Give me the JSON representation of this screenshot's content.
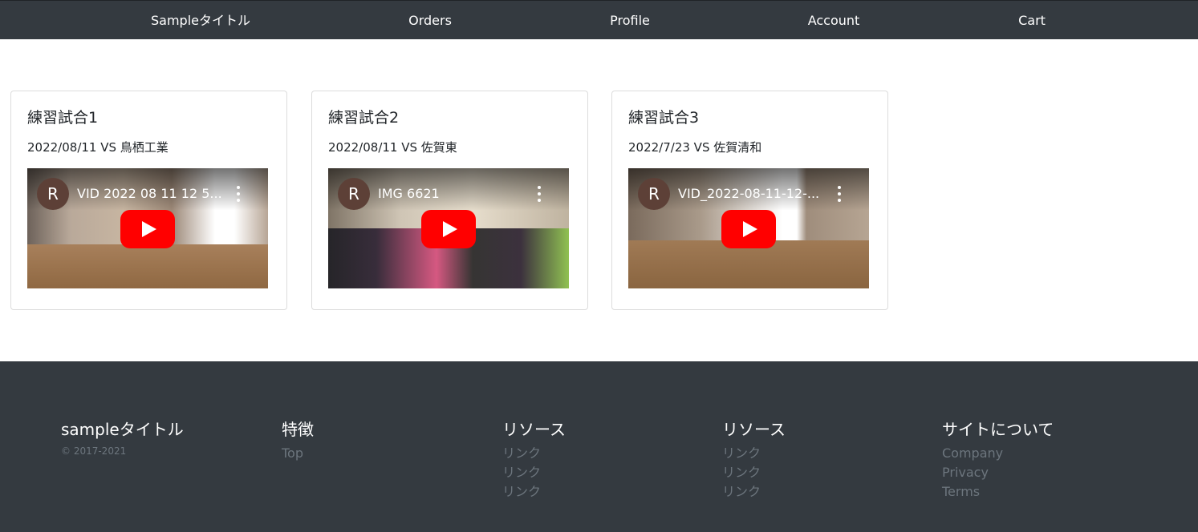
{
  "nav": {
    "items": [
      {
        "label": "Sampleタイトル"
      },
      {
        "label": "Orders"
      },
      {
        "label": "Profile"
      },
      {
        "label": "Account"
      },
      {
        "label": "Cart"
      }
    ]
  },
  "cards": [
    {
      "title": "練習試合1",
      "subtitle": "2022/08/11 VS 鳥栖工業",
      "video": {
        "channel_initial": "R",
        "title": "VID 2022 08 11 12 5...",
        "icon": "youtube-play-icon"
      }
    },
    {
      "title": "練習試合2",
      "subtitle": "2022/08/11 VS 佐賀東",
      "video": {
        "channel_initial": "R",
        "title": "IMG 6621",
        "icon": "youtube-play-icon"
      }
    },
    {
      "title": "練習試合3",
      "subtitle": "2022/7/23 VS 佐賀清和",
      "video": {
        "channel_initial": "R",
        "title": "VID_2022-08-11-12-...",
        "icon": "youtube-play-icon"
      }
    }
  ],
  "footer": {
    "brand": "sampleタイトル",
    "copyright": "© 2017-2021",
    "columns": [
      {
        "heading": "特徴",
        "links": [
          "Top"
        ]
      },
      {
        "heading": "リソース",
        "links": [
          "リンク",
          "リンク",
          "リンク"
        ]
      },
      {
        "heading": "リソース",
        "links": [
          "リンク",
          "リンク",
          "リンク"
        ]
      },
      {
        "heading": "サイトについて",
        "links": [
          "Company",
          "Privacy",
          "Terms"
        ]
      }
    ]
  },
  "colors": {
    "nav_bg": "#343a40",
    "footer_bg": "#343a40",
    "play_button": "#ff0000",
    "muted_link": "#6c757d"
  }
}
